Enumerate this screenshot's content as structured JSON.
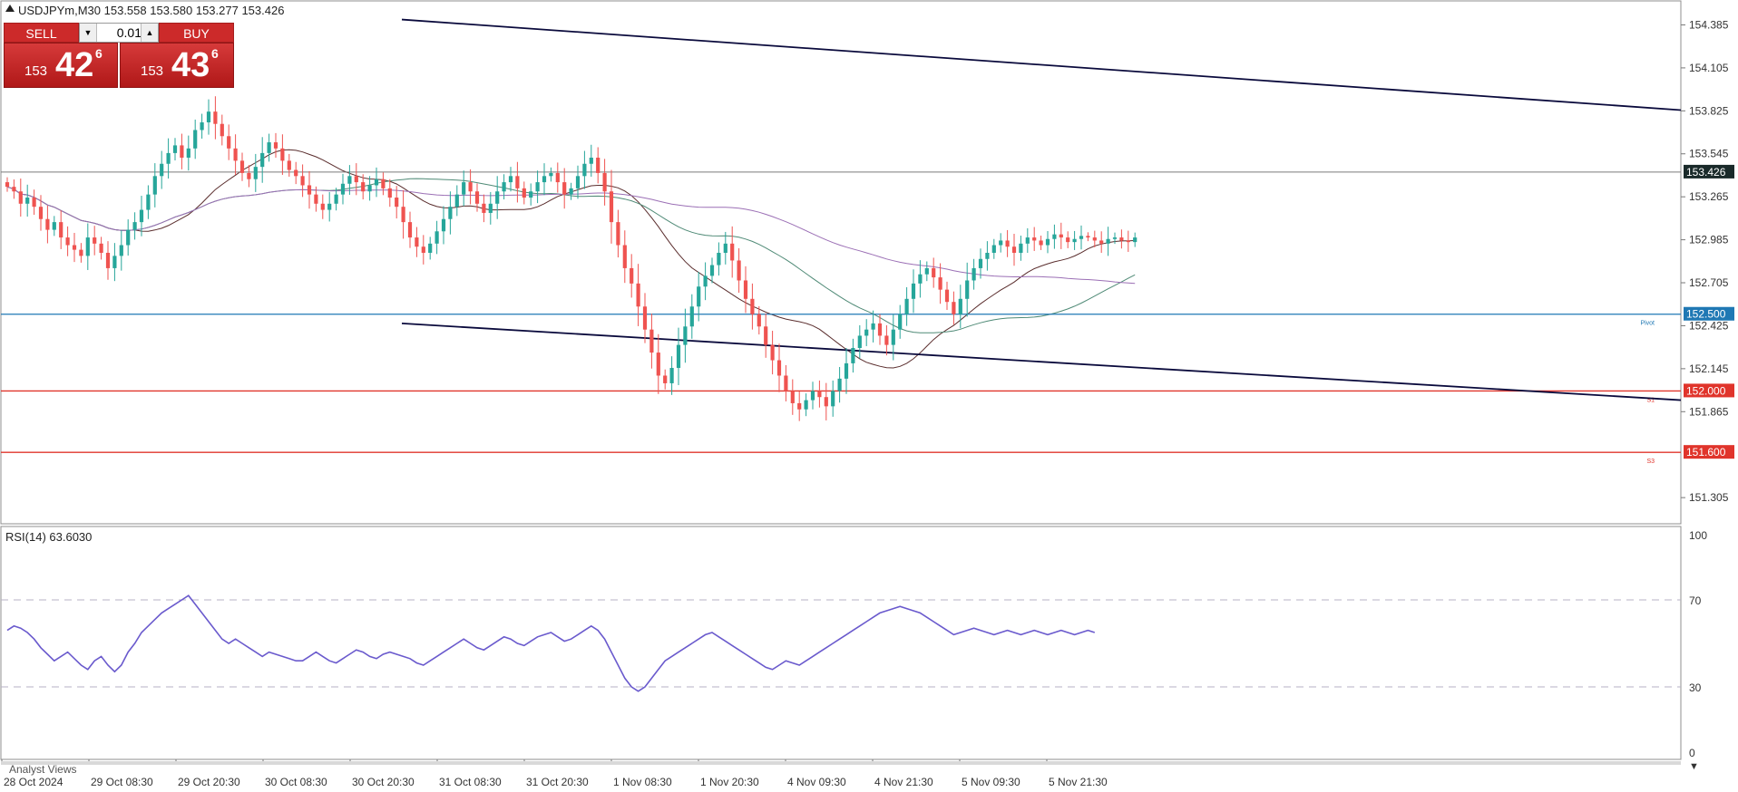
{
  "header": {
    "symbol_line": "USDJPYm,M30  153.558 153.580 153.277 153.426",
    "rsi_label": "RSI(14) 63.6030",
    "footer_tab": "Analyst Views"
  },
  "trade_panel": {
    "sell_label": "SELL",
    "buy_label": "BUY",
    "volume": "0.01",
    "sell_big": "153",
    "sell_pips": "42",
    "sell_frac": "6",
    "buy_big": "153",
    "buy_pips": "43",
    "buy_frac": "6"
  },
  "colors": {
    "bull": "#26a69a",
    "bear": "#ef5350",
    "wick": "#555555",
    "ma_fast": "#5a2d2d",
    "ma_mid": "#4f8a76",
    "ma_slow": "#9b6fb5",
    "rsi": "#6a5acd",
    "trend": "#0a0a3c",
    "pivot": "#1f78b4",
    "support": "#e0342b",
    "current": "#1a2a2a"
  },
  "chart_data": {
    "type": "candlestick",
    "symbol": "USDJPYm",
    "timeframe": "M30",
    "ohlc_current": {
      "open": 153.558,
      "high": 153.58,
      "low": 153.277,
      "close": 153.426
    },
    "ylim": [
      151.17,
      154.5
    ],
    "y_ticks": [
      "154.385",
      "154.105",
      "153.825",
      "153.545",
      "153.265",
      "152.985",
      "152.705",
      "152.425",
      "152.145",
      "151.865",
      "151.305"
    ],
    "x_ticks": [
      "28 Oct 2024",
      "29 Oct 08:30",
      "29 Oct 20:30",
      "30 Oct 08:30",
      "30 Oct 20:30",
      "31 Oct 08:30",
      "31 Oct 20:30",
      "1 Nov 08:30",
      "1 Nov 20:30",
      "4 Nov 09:30",
      "4 Nov 21:30",
      "5 Nov 09:30",
      "5 Nov 21:30"
    ],
    "current_price": {
      "label": "153.426",
      "value": 153.426
    },
    "levels": [
      {
        "label": "152.500",
        "value": 152.5,
        "tag": "Pivot",
        "kind": "pivot"
      },
      {
        "label": "152.000",
        "value": 152.0,
        "tag": "S1",
        "kind": "support"
      },
      {
        "label": "151.600",
        "value": 151.6,
        "tag": "S3",
        "kind": "support"
      }
    ],
    "trendlines": [
      {
        "from": {
          "bar": 0,
          "price": 154.42
        },
        "to": {
          "bar": 161,
          "price": 153.83
        }
      },
      {
        "from": {
          "bar": 0,
          "price": 152.44
        },
        "to": {
          "bar": 161,
          "price": 151.94
        }
      }
    ],
    "first_bar_x_offset": -48,
    "closes": [
      153.33,
      153.3,
      153.22,
      153.26,
      153.2,
      153.12,
      153.05,
      153.1,
      153.0,
      152.95,
      152.92,
      152.88,
      153.0,
      152.96,
      152.9,
      152.8,
      152.88,
      152.95,
      153.05,
      153.1,
      153.18,
      153.28,
      153.4,
      153.48,
      153.55,
      153.6,
      153.52,
      153.58,
      153.7,
      153.75,
      153.82,
      153.74,
      153.66,
      153.58,
      153.5,
      153.42,
      153.38,
      153.46,
      153.55,
      153.62,
      153.58,
      153.5,
      153.44,
      153.4,
      153.34,
      153.28,
      153.22,
      153.18,
      153.22,
      153.28,
      153.35,
      153.4,
      153.36,
      153.3,
      153.34,
      153.38,
      153.32,
      153.26,
      153.2,
      153.1,
      153.0,
      152.94,
      152.9,
      152.96,
      153.04,
      153.12,
      153.2,
      153.28,
      153.36,
      153.3,
      153.22,
      153.16,
      153.22,
      153.3,
      153.36,
      153.4,
      153.32,
      153.26,
      153.3,
      153.36,
      153.4,
      153.42,
      153.36,
      153.28,
      153.32,
      153.4,
      153.48,
      153.52,
      153.42,
      153.3,
      153.1,
      152.95,
      152.8,
      152.7,
      152.55,
      152.4,
      152.25,
      152.1,
      152.05,
      152.15,
      152.3,
      152.42,
      152.55,
      152.68,
      152.75,
      152.82,
      152.9,
      152.96,
      152.85,
      152.72,
      152.6,
      152.5,
      152.42,
      152.3,
      152.2,
      152.1,
      152.0,
      151.92,
      151.88,
      151.94,
      152.0,
      151.96,
      151.9,
      152.0,
      152.08,
      152.18,
      152.28,
      152.36,
      152.4,
      152.44,
      152.36,
      152.3,
      152.4,
      152.5,
      152.6,
      152.7,
      152.76,
      152.8,
      152.74,
      152.66,
      152.58,
      152.5,
      152.6,
      152.72,
      152.8,
      152.86,
      152.9,
      152.95,
      152.98,
      152.94,
      152.9,
      152.96,
      153.0,
      152.98,
      152.95,
      152.99,
      153.02,
      153.0,
      152.97,
      152.99,
      153.01,
      153.0,
      152.98,
      152.96,
      152.99,
      153.0,
      152.98,
      152.97,
      153.0
    ]
  },
  "rsi_data": {
    "ylim": [
      0,
      100
    ],
    "ticks": [
      "100",
      "70",
      "30",
      "0"
    ],
    "levels": [
      70,
      30
    ],
    "values": [
      56,
      58,
      57,
      55,
      52,
      48,
      45,
      42,
      44,
      46,
      43,
      40,
      38,
      42,
      44,
      40,
      37,
      40,
      46,
      50,
      55,
      58,
      61,
      64,
      66,
      68,
      70,
      72,
      68,
      64,
      60,
      56,
      52,
      50,
      52,
      50,
      48,
      46,
      44,
      46,
      45,
      44,
      43,
      42,
      42,
      44,
      46,
      44,
      42,
      41,
      43,
      45,
      47,
      46,
      44,
      43,
      45,
      46,
      45,
      44,
      43,
      41,
      40,
      42,
      44,
      46,
      48,
      50,
      52,
      50,
      48,
      47,
      49,
      51,
      53,
      52,
      50,
      49,
      51,
      53,
      54,
      55,
      53,
      51,
      52,
      54,
      56,
      58,
      56,
      52,
      46,
      40,
      34,
      30,
      28,
      30,
      34,
      38,
      42,
      44,
      46,
      48,
      50,
      52,
      54,
      55,
      53,
      51,
      49,
      47,
      45,
      43,
      41,
      39,
      38,
      40,
      42,
      41,
      40,
      42,
      44,
      46,
      48,
      50,
      52,
      54,
      56,
      58,
      60,
      62,
      64,
      65,
      66,
      67,
      66,
      65,
      64,
      62,
      60,
      58,
      56,
      54,
      55,
      56,
      57,
      56,
      55,
      54,
      55,
      56,
      55,
      54,
      55,
      56,
      55,
      54,
      55,
      56,
      55,
      54,
      55,
      56,
      55
    ]
  }
}
